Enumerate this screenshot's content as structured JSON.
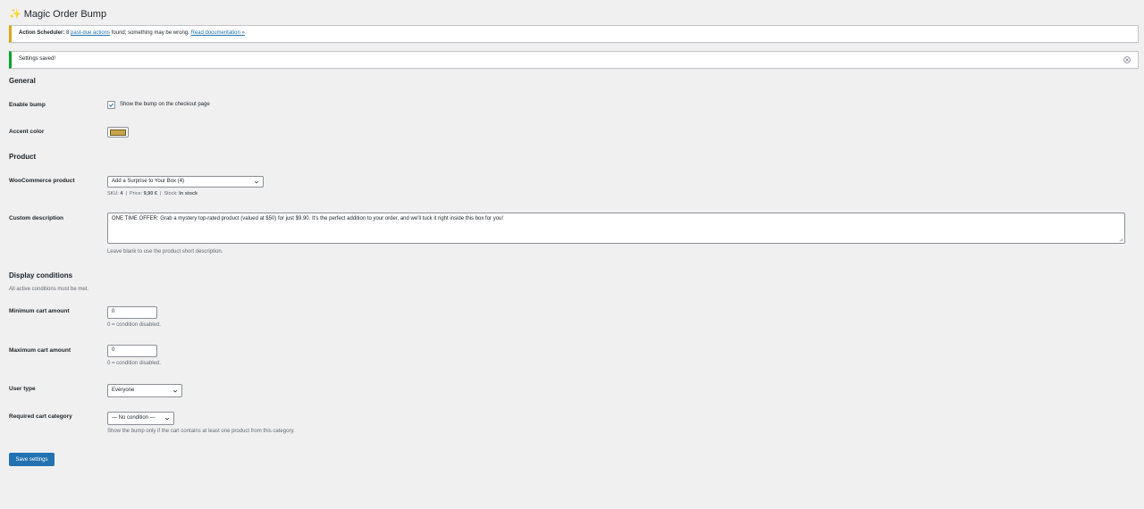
{
  "header": {
    "title_icon": "sparkles-icon",
    "title": "Magic Order Bump"
  },
  "notices": {
    "warning": {
      "prefix": "Action Scheduler:",
      "count_text": "8",
      "link1": "past-due actions",
      "middle": "found; something may be wrong.",
      "link2": "Read documentation »"
    },
    "success": {
      "text": "Settings saved!"
    }
  },
  "general": {
    "heading": "General",
    "enable_bump": {
      "label": "Enable bump",
      "checked": true,
      "checkbox_label": "Show the bump on the checkout page"
    },
    "accent_color": {
      "label": "Accent color",
      "value": "#c9a64a"
    }
  },
  "product": {
    "heading": "Product",
    "woocommerce_product": {
      "label": "WooCommerce product",
      "selected": "Add a Surprise to Your Box (4)",
      "sku_label": "SKU:",
      "sku": "4",
      "price_label": "Price:",
      "price": "9,90 €",
      "stock_label": "Stock:",
      "stock": "In stock",
      "sep": "|"
    },
    "custom_description": {
      "label": "Custom description",
      "value": "ONE TIME OFFER: Grab a mystery top-rated product (valued at $50) for just $9.90. It's the perfect addition to your order, and we'll tuck it right inside this box for you!",
      "help": "Leave blank to use the product short description."
    }
  },
  "display_conditions": {
    "heading": "Display conditions",
    "subtitle": "All active conditions must be met.",
    "min_cart": {
      "label": "Minimum cart amount",
      "value": "0",
      "help": "0 = condition disabled."
    },
    "max_cart": {
      "label": "Maximum cart amount",
      "value": "0",
      "help": "0 = condition disabled."
    },
    "user_type": {
      "label": "User type",
      "selected": "Everyone"
    },
    "required_category": {
      "label": "Required cart category",
      "selected": "— No condition —",
      "help": "Show the bump only if the cart contains at least one product from this category."
    }
  },
  "actions": {
    "save_label": "Save settings"
  },
  "colors": {
    "primary": "#2271b1",
    "warning": "#dba617",
    "success": "#00a32a",
    "accent": "#c9a64a"
  }
}
